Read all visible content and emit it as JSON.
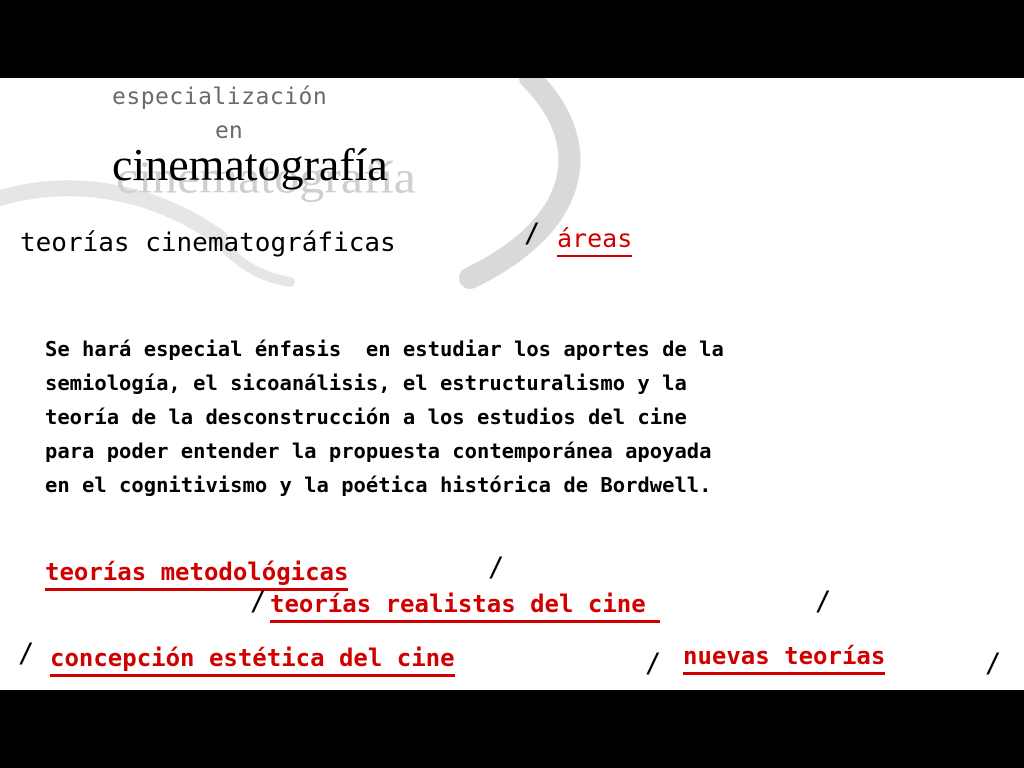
{
  "brand": {
    "line1": "especialización",
    "line2": "en",
    "title": "cinematografía"
  },
  "heading": {
    "title": "teorías cinematográficas",
    "separator": "/",
    "link": "áreas"
  },
  "body": {
    "lines": [
      "Se hará especial énfasis  en estudiar los aportes de la",
      "semiología, el sicoanálisis, el estructuralismo y la",
      "teoría de la desconstrucción a los estudios del cine",
      "para poder entender la propuesta contemporánea apoyada",
      "en el cognitivismo y la poética histórica de Bordwell."
    ]
  },
  "links": {
    "metodologicas": "teorías metodológicas",
    "realistas": "teorías realistas del cine ",
    "estetica": "concepción estética del cine",
    "nuevas": "nuevas teorías"
  },
  "colors": {
    "link": "#d00000",
    "background": "#ffffff",
    "frame": "#000000"
  }
}
